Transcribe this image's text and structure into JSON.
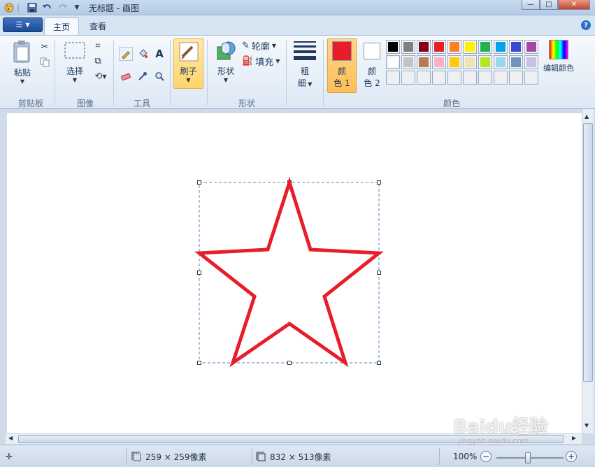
{
  "window": {
    "title": "无标题 - 画图"
  },
  "tabs": [
    {
      "label": "主页"
    },
    {
      "label": "查看"
    }
  ],
  "ribbon": {
    "clipboard": {
      "paste_label": "粘贴",
      "group_label": "剪贴板"
    },
    "image": {
      "select_label": "选择",
      "group_label": "图像"
    },
    "tools": {
      "group_label": "工具"
    },
    "brushes": {
      "label": "刷子"
    },
    "shapes": {
      "label": "形状",
      "outline_label": "轮廓",
      "fill_label": "填充",
      "group_label": "形状"
    },
    "size": {
      "label_line1": "粗",
      "label_line2": "细"
    },
    "color1": {
      "line1": "颜",
      "line2": "色 1",
      "value": "#e81d2a"
    },
    "color2": {
      "line1": "颜",
      "line2": "色 2",
      "value": "#ffffff"
    },
    "edit_colors_label": "编辑颜色",
    "colors_group_label": "颜色",
    "palette_row1": [
      "#000000",
      "#7f7f7f",
      "#880015",
      "#ed1c24",
      "#ff7f27",
      "#fff200",
      "#22b14c",
      "#00a2e8",
      "#3f48cc",
      "#a349a4"
    ],
    "palette_row2": [
      "#ffffff",
      "#c3c3c3",
      "#b97a57",
      "#ffaec9",
      "#ffc90e",
      "#efe4b0",
      "#b5e61d",
      "#99d9ea",
      "#7092be",
      "#c8bfe7"
    ],
    "palette_row3": [
      "#f0f0f0",
      "#f0f0f0",
      "#f0f0f0",
      "#f0f0f0",
      "#f0f0f0",
      "#f0f0f0",
      "#f0f0f0",
      "#f0f0f0",
      "#f0f0f0",
      "#f0f0f0"
    ]
  },
  "canvas": {
    "star_color": "#e81d2a"
  },
  "status": {
    "selection_size": "259 × 259像素",
    "canvas_size": "832 × 513像素",
    "zoom": "100%"
  },
  "watermark": {
    "text": "Baidu经验",
    "sub": "jingyan.baidu.com"
  }
}
